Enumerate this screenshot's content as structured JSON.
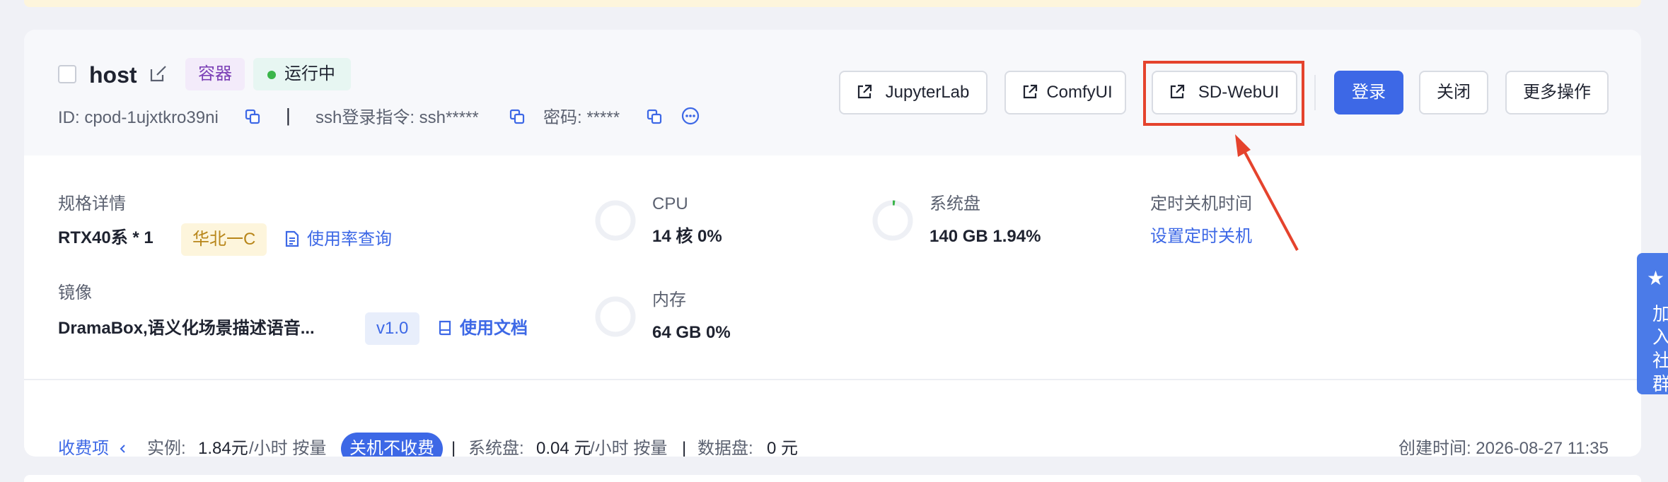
{
  "instance": {
    "name": "host",
    "tag_type": "容器",
    "status": "运行中",
    "id_label": "ID: cpod-1ujxtkro39ni",
    "separator": "|",
    "ssh_label": "ssh登录指令: ssh*****",
    "password_label": "密码: *****"
  },
  "actions": {
    "jupyter": "JupyterLab",
    "comfy": "ComfyUI",
    "sdwebui": "SD-WebUI",
    "login": "登录",
    "close": "关闭",
    "more": "更多操作"
  },
  "spec": {
    "label": "规格详情",
    "value": "RTX40系 * 1",
    "region": "华北一C",
    "usage_link": "使用率查询"
  },
  "image": {
    "label": "镜像",
    "value": "DramaBox,语义化场景描述语音...",
    "version": "v1.0",
    "docs_link": "使用文档"
  },
  "cpu": {
    "label": "CPU",
    "value": "14 核 0%",
    "usage": 0
  },
  "memory": {
    "label": "内存",
    "value": "64 GB 0%",
    "usage": 0
  },
  "disk": {
    "label": "系统盘",
    "value": "140 GB 1.94%",
    "usage": 0.0194
  },
  "shutdown": {
    "label": "定时关机时间",
    "link": "设置定时关机"
  },
  "billing": {
    "label": "收费项",
    "instance_key": "实例:",
    "instance_value": "1.84元",
    "instance_unit": "/小时 按量",
    "off_free": "关机不收费",
    "sep": "|",
    "disk_key": "系统盘:",
    "disk_value": "0.04 元",
    "disk_unit": "/小时 按量",
    "data_key": "数据盘:",
    "data_value": "0 元"
  },
  "created": "创建时间: 2026-08-27 11:35",
  "side_tab": {
    "text": "加入社群"
  },
  "colors": {
    "primary": "#3d68e6",
    "running_dot": "#3bb54a",
    "highlight": "#e5432d",
    "container_tag": "#7b3fb6",
    "region_tag": "#b8861a"
  },
  "icons": [
    "edit-icon",
    "copy-icon",
    "more-circle-icon",
    "external-link-icon",
    "document-icon",
    "book-icon",
    "chevron-left-icon",
    "star-icon"
  ]
}
